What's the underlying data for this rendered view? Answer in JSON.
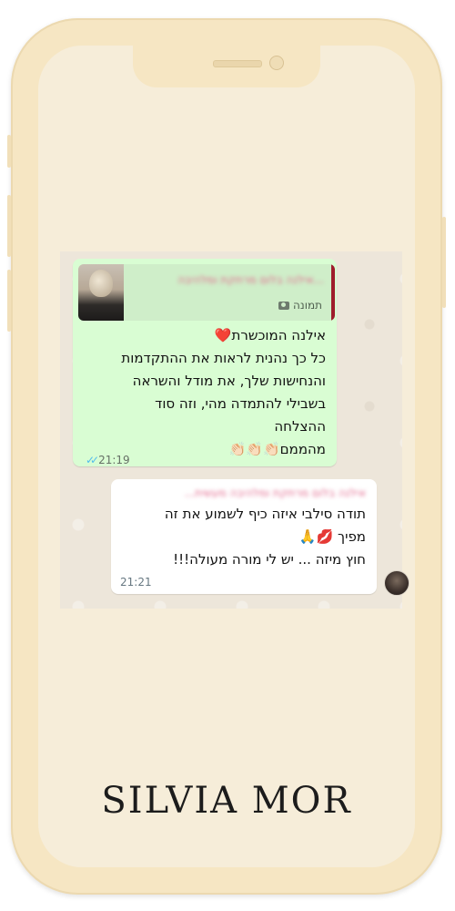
{
  "colors": {
    "phone_frame": "#f6e6c3",
    "screen_bg": "#f6edd9",
    "outgoing_bubble": "#d9fdd3",
    "incoming_bubble": "#ffffff",
    "quote_bar": "#9e1d2c",
    "read_ticks": "#53bdeb"
  },
  "chat": {
    "outgoing": {
      "quote": {
        "sender": "אילנה בלום מרתקת ומלהיבה...",
        "type_label": "תמונה",
        "type_icon": "camera-icon"
      },
      "lines": [
        "אילנה המוכשרת❤️",
        "כל כך נהנית לראות את ההתקדמות",
        "והנחישות שלך, את מודל והשראה",
        "בשבילי להתמדה מהי, וזה סוד",
        "ההצלחה",
        "מהממם👏🏻👏🏻👏🏻"
      ],
      "time": "21:19",
      "status_icon": "double-check-icon"
    },
    "incoming": {
      "quote_sender": "אילנה בלום מרתקת ומלהיבה מעשית...",
      "lines": [
        "תודה סילבי איזה כיף לשמוע את זה",
        "מפיך 💋🙏",
        "חוץ מיזה ... יש לי מורה מעולה!!!"
      ],
      "time": "21:21"
    }
  },
  "brand": {
    "name": "SILVIA MOR"
  }
}
